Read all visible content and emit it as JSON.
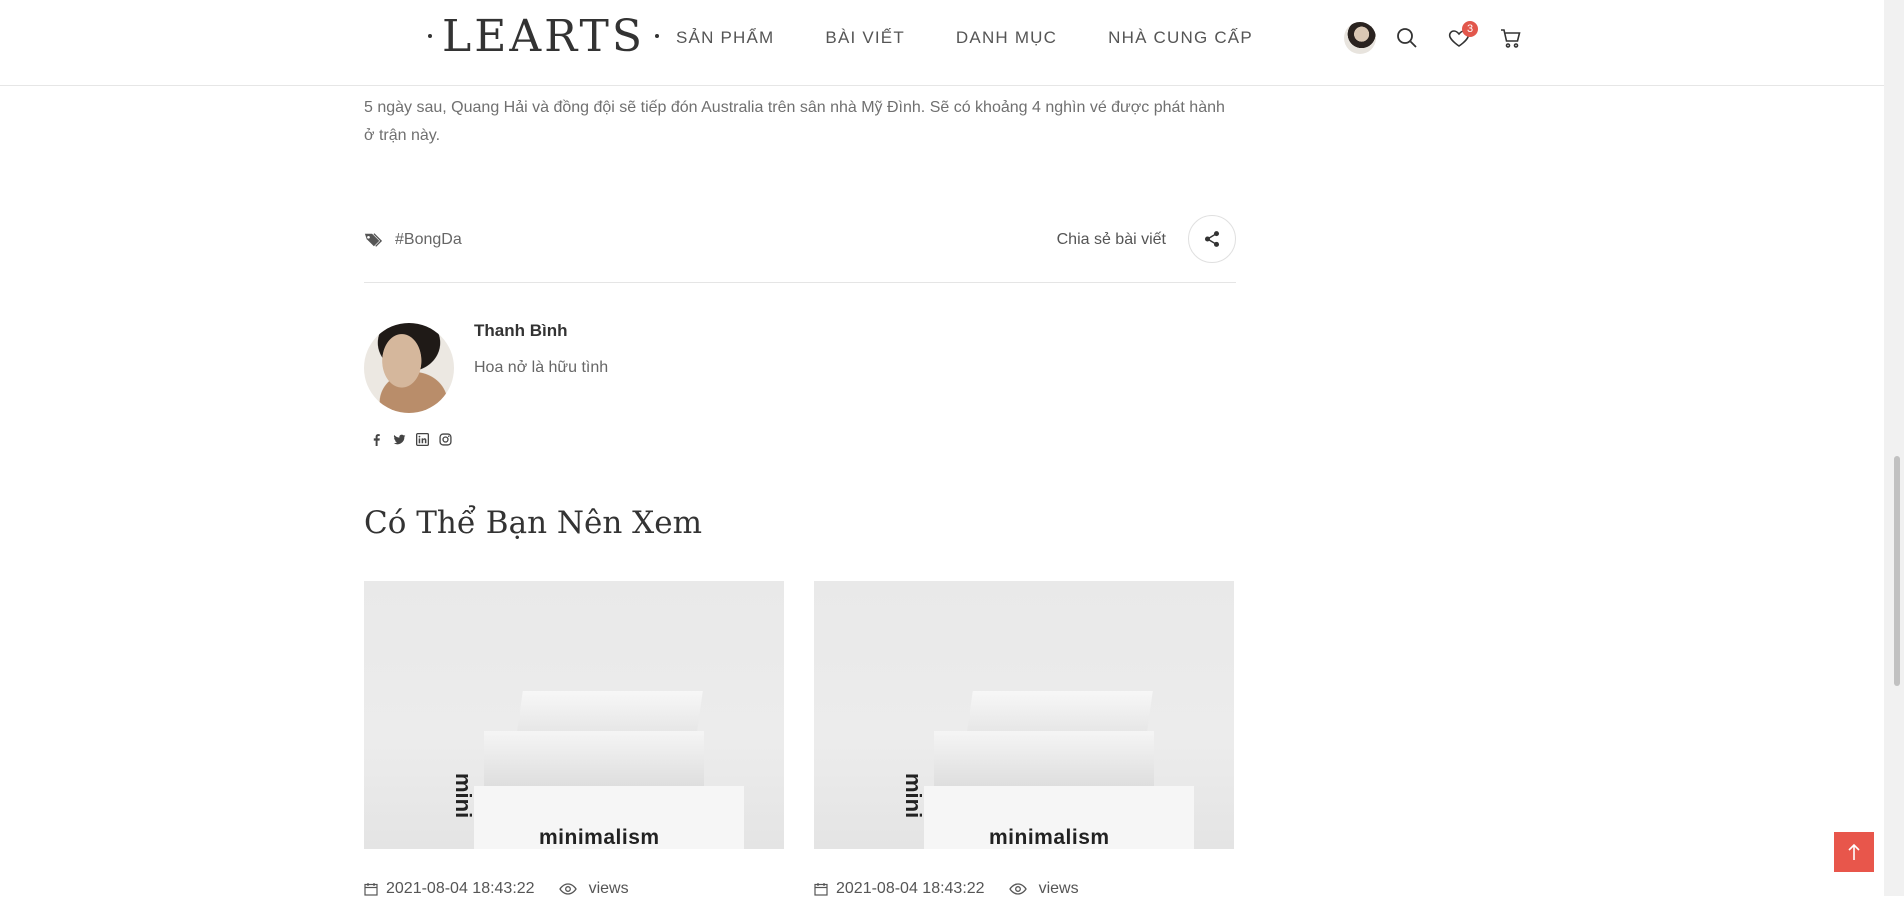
{
  "header": {
    "logo_text": "LEARTS",
    "nav": [
      {
        "label": "SẢN PHẨM"
      },
      {
        "label": "BÀI VIẾT"
      },
      {
        "label": "DANH MỤC"
      },
      {
        "label": "NHÀ CUNG CẤP"
      }
    ],
    "wishlist_count": "3"
  },
  "article": {
    "paragraph": "5 ngày sau, Quang Hải và đồng đội sẽ tiếp đón Australia trên sân nhà Mỹ Đình. Sẽ có khoảng 4 nghìn vé được phát hành ở trận này.",
    "tag": "#BongDa",
    "share_label": "Chia sẻ bài viết"
  },
  "author": {
    "name": "Thanh Bình",
    "bio": "Hoa nở là hữu tình",
    "socials": [
      "facebook-icon",
      "twitter-icon",
      "linkedin-icon",
      "instagram-icon"
    ]
  },
  "related": {
    "title": "Có Thể Bạn Nên Xem",
    "cards": [
      {
        "date": "2021-08-04 18:43:22",
        "views": "views",
        "image_text": "minimalism",
        "image_side_text": "mini"
      },
      {
        "date": "2021-08-04 18:43:22",
        "views": "views",
        "image_text": "minimalism",
        "image_side_text": "mini"
      }
    ]
  },
  "colors": {
    "accent": "#e8564b",
    "text": "#333333",
    "muted": "#707070"
  }
}
